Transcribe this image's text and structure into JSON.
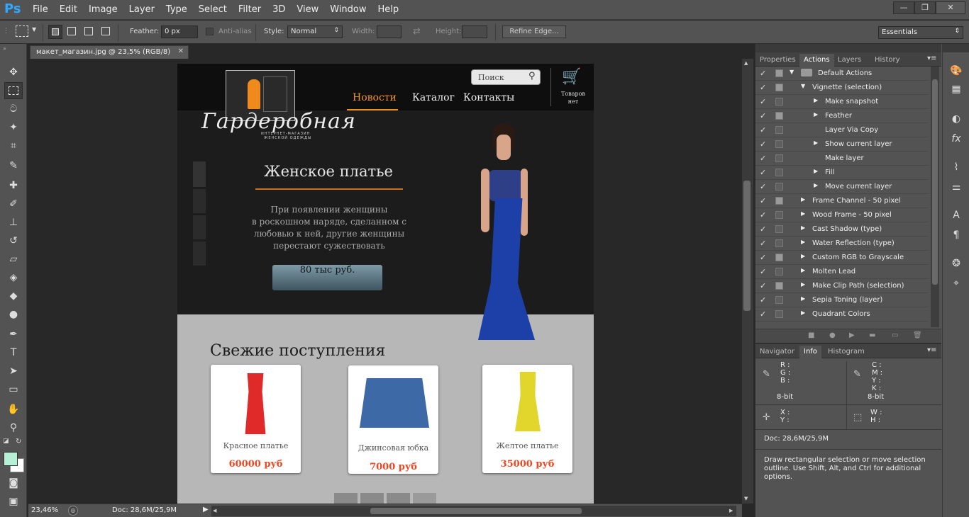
{
  "app": {
    "logo": "Ps"
  },
  "menu": [
    "File",
    "Edit",
    "Image",
    "Layer",
    "Type",
    "Select",
    "Filter",
    "3D",
    "View",
    "Window",
    "Help"
  ],
  "options": {
    "feather_label": "Feather:",
    "feather_value": "0 px",
    "antialias_label": "Anti-alias",
    "style_label": "Style:",
    "style_value": "Normal",
    "width_label": "Width:",
    "height_label": "Height:",
    "refine_button": "Refine Edge...",
    "workspace": "Essentials"
  },
  "document": {
    "tab_title": "макет_магазин.jpg @ 23,5% (RGB/8)",
    "zoom": "23,46%",
    "doc_size": "Doc: 28,6M/25,9M"
  },
  "site": {
    "search_placeholder": "Поиск",
    "nav": [
      "Новости",
      "Каталог",
      "Контакты"
    ],
    "cart_text_1": "Товаров",
    "cart_text_2": "нет",
    "logo_script": "Гардеробная",
    "logo_sub1": "ИНТЕРНЕТ-МАГАЗИН",
    "logo_sub2": "ЖЕНСКОЙ ОДЕЖДЫ",
    "hero_title": "Женское платье",
    "hero_text": [
      "При появлении женщины",
      "в роскошном наряде, сделанном с",
      "любовью к ней, другие женщины",
      "перестают сужествовать"
    ],
    "hero_button": "80 тыс руб.",
    "section_title": "Свежие поступления",
    "products": [
      {
        "name": "Красное платье",
        "price": "60000 руб"
      },
      {
        "name": "Джинсовая юбка",
        "price": "7000 руб"
      },
      {
        "name": "Желтое платье",
        "price": "35000 руб"
      }
    ]
  },
  "panel_tabs_top": [
    "Properties",
    "Actions",
    "Layers",
    "History"
  ],
  "actions": [
    {
      "label": "Default Actions",
      "level": 0,
      "expanded": true,
      "folder": true,
      "dialog": true
    },
    {
      "label": "Vignette (selection)",
      "level": 1,
      "expanded": true,
      "dialog": true
    },
    {
      "label": "Make snapshot",
      "level": 2,
      "arrow": true,
      "dialog": false
    },
    {
      "label": "Feather",
      "level": 2,
      "arrow": true,
      "dialog": true
    },
    {
      "label": "Layer Via Copy",
      "level": 2,
      "arrow": false,
      "dialog": false
    },
    {
      "label": "Show current layer",
      "level": 2,
      "arrow": true,
      "dialog": false
    },
    {
      "label": "Make layer",
      "level": 2,
      "arrow": false,
      "dialog": false
    },
    {
      "label": "Fill",
      "level": 2,
      "arrow": true,
      "dialog": false
    },
    {
      "label": "Move current layer",
      "level": 2,
      "arrow": true,
      "dialog": false
    },
    {
      "label": "Frame Channel - 50 pixel",
      "level": 1,
      "arrow": true,
      "dialog": true
    },
    {
      "label": "Wood Frame - 50 pixel",
      "level": 1,
      "arrow": true,
      "dialog": false
    },
    {
      "label": "Cast Shadow (type)",
      "level": 1,
      "arrow": true,
      "dialog": false
    },
    {
      "label": "Water Reflection (type)",
      "level": 1,
      "arrow": true,
      "dialog": false
    },
    {
      "label": "Custom RGB to Grayscale",
      "level": 1,
      "arrow": true,
      "dialog": true
    },
    {
      "label": "Molten Lead",
      "level": 1,
      "arrow": true,
      "dialog": false
    },
    {
      "label": "Make Clip Path (selection)",
      "level": 1,
      "arrow": true,
      "dialog": true
    },
    {
      "label": "Sepia Toning (layer)",
      "level": 1,
      "arrow": true,
      "dialog": false
    },
    {
      "label": "Quadrant Colors",
      "level": 1,
      "arrow": true,
      "dialog": false
    }
  ],
  "panel_tabs_bottom": [
    "Navigator",
    "Info",
    "Histogram"
  ],
  "info": {
    "r": "R :",
    "g": "G :",
    "b": "B :",
    "c": "C :",
    "m": "M :",
    "y": "Y :",
    "k": "K :",
    "bit1": "8-bit",
    "bit2": "8-bit",
    "x": "X :",
    "yy": "Y :",
    "w": "W :",
    "h": "H :",
    "doc": "Doc: 28,6M/25,9M",
    "hint": "Draw rectangular selection or move selection outline.  Use Shift, Alt, and Ctrl for additional options."
  },
  "colors": {
    "foreground": "#b7f0d4",
    "background": "#ffffff",
    "accent_orange": "#f0931e",
    "price_red": "#ee4722"
  }
}
